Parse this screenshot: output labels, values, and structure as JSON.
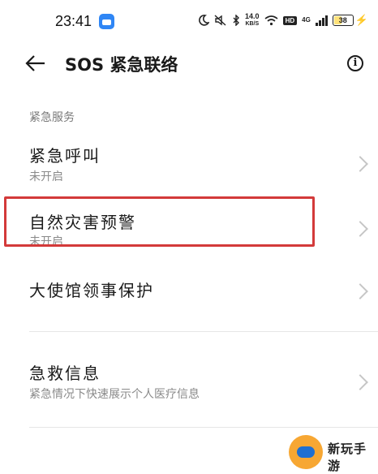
{
  "status_bar": {
    "time": "23:41",
    "speed_value": "14.0",
    "speed_unit": "KB/S",
    "hd": "HD",
    "network": "4G",
    "battery": "38",
    "battery_level": 0.38,
    "accent": "#3aa0ff"
  },
  "header": {
    "title": "SOS 紧急联络"
  },
  "section": {
    "label": "紧急服务"
  },
  "items": [
    {
      "title": "紧急呼叫",
      "subtitle": "未开启"
    },
    {
      "title": "自然灾害预警",
      "subtitle": "未开启"
    },
    {
      "title": "大使馆领事保护"
    },
    {
      "title": "急救信息",
      "subtitle": "紧急情况下快速展示个人医疗信息"
    }
  ],
  "watermark": {
    "text": "新玩手游"
  },
  "colors": {
    "highlight": "#d33a3a",
    "chevron": "#c6c6c6",
    "secondary_text": "#8a8a8a"
  }
}
